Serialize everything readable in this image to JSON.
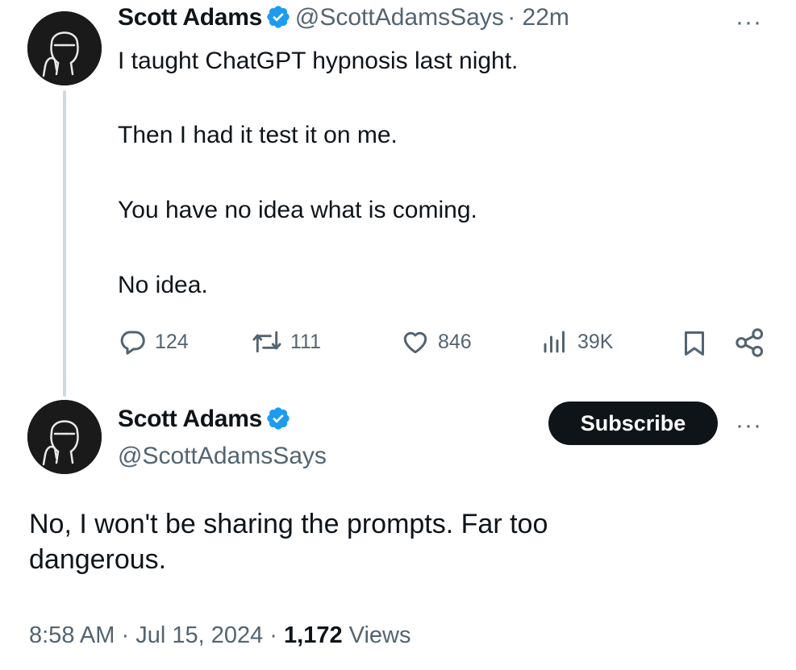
{
  "tweet": {
    "author_name": "Scott Adams",
    "handle": "@ScottAdamsSays",
    "time_ago": "· 22m",
    "lines": [
      "I taught ChatGPT hypnosis last night.",
      "Then I had it test it on me.",
      "You have no idea what is coming.",
      "No idea."
    ],
    "replies": "124",
    "reposts": "111",
    "likes": "846",
    "views": "39K",
    "more_label": "···"
  },
  "reply": {
    "author_name": "Scott Adams",
    "handle": "@ScottAdamsSays",
    "subscribe_label": "Subscribe",
    "more_label": "···",
    "text_line1": "No, I won't be sharing the prompts. Far too",
    "text_line2": "dangerous.",
    "time": "8:58 AM",
    "date": "Jul 15, 2024",
    "views_count": "1,172",
    "views_label": "Views",
    "separator": "·"
  },
  "colors": {
    "text": "#0f1419",
    "secondary": "#536471",
    "verified_blue": "#1d9bf0",
    "thread_line": "#cfd9de"
  }
}
